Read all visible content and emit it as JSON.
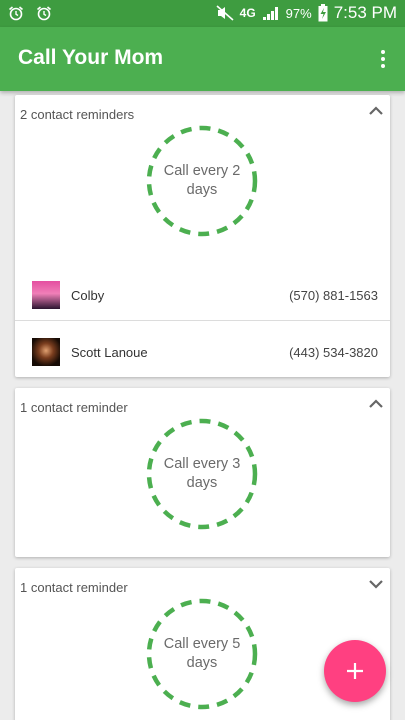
{
  "status_bar": {
    "network": "4G",
    "battery": "97%",
    "time": "7:53 PM"
  },
  "app_bar": {
    "title": "Call Your Mom"
  },
  "cards": [
    {
      "count_label": "2 contact reminders",
      "ring_text": "Call every 2 days",
      "expanded": true,
      "contacts": [
        {
          "name": "Colby",
          "phone": "(570) 881-1563"
        },
        {
          "name": "Scott Lanoue",
          "phone": "(443) 534-3820"
        }
      ]
    },
    {
      "count_label": "1 contact reminder",
      "ring_text": "Call every 3 days",
      "expanded": true,
      "contacts": []
    },
    {
      "count_label": "1 contact reminder",
      "ring_text": "Call every 5 days",
      "expanded": false,
      "contacts": []
    }
  ],
  "colors": {
    "status_bar": "#3e9c40",
    "app_bar": "#4caf50",
    "ring": "#4caf50",
    "fab": "#ff4081"
  },
  "icons": {
    "status_left": [
      "alarm-icon",
      "alarm-icon"
    ],
    "status_right": [
      "mute-icon",
      "signal-icon",
      "battery-charging-icon"
    ],
    "overflow": "more-vert-icon",
    "fab": "plus-icon"
  }
}
